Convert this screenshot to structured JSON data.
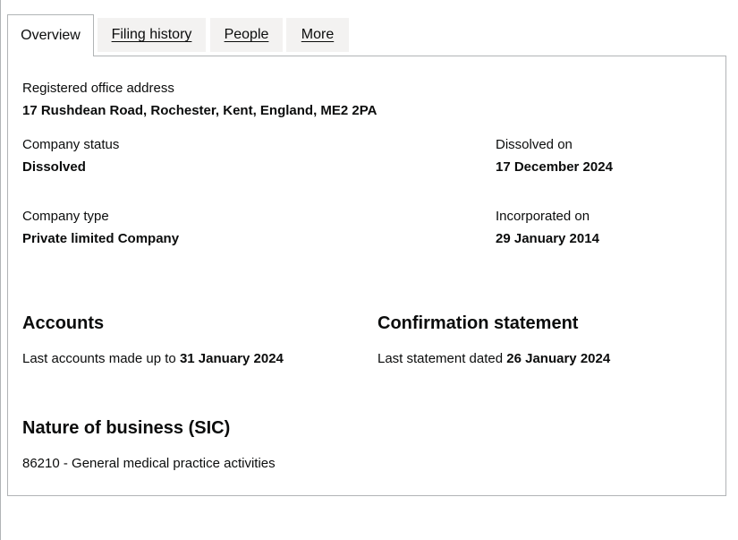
{
  "tabs": [
    {
      "label": "Overview",
      "active": true
    },
    {
      "label": "Filing history",
      "active": false
    },
    {
      "label": "People",
      "active": false
    },
    {
      "label": "More",
      "active": false
    }
  ],
  "overview": {
    "registered_office_label": "Registered office address",
    "registered_office_value": "17 Rushdean Road, Rochester, Kent, England, ME2 2PA",
    "company_status_label": "Company status",
    "company_status_value": "Dissolved",
    "dissolved_on_label": "Dissolved on",
    "dissolved_on_value": "17 December 2024",
    "company_type_label": "Company type",
    "company_type_value": "Private limited Company",
    "incorporated_on_label": "Incorporated on",
    "incorporated_on_value": "29 January 2014"
  },
  "accounts": {
    "heading": "Accounts",
    "text": "Last accounts made up to",
    "date": "31 January 2024"
  },
  "confirmation": {
    "heading": "Confirmation statement",
    "text": "Last statement dated",
    "date": "26 January 2024"
  },
  "sic": {
    "heading": "Nature of business (SIC)",
    "item": "86210 - General medical practice activities"
  }
}
